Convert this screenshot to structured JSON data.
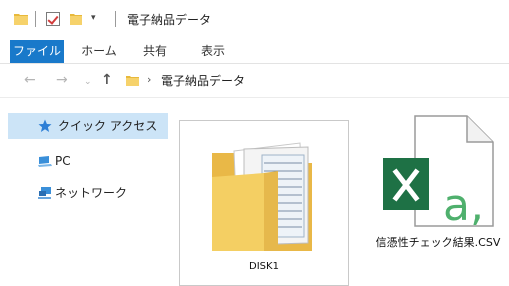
{
  "window": {
    "title": "電子納品データ"
  },
  "quick_access_toolbar": {
    "dropdown_glyph": "▾"
  },
  "ribbon": {
    "tabs": [
      {
        "label": "ファイル",
        "active": true
      },
      {
        "label": "ホーム"
      },
      {
        "label": "共有"
      },
      {
        "label": "表示"
      }
    ]
  },
  "address_bar": {
    "back": "←",
    "forward": "→",
    "recent": "⌄",
    "up": "↑",
    "separator": "›",
    "path": "電子納品データ"
  },
  "navigation_pane": {
    "items": [
      {
        "label": "クイック アクセス",
        "icon": "star-icon",
        "selected": true
      },
      {
        "label": "PC",
        "icon": "computer-icon"
      },
      {
        "label": "ネットワーク",
        "icon": "network-icon"
      }
    ]
  },
  "files": [
    {
      "name": "DISK1",
      "type": "folder",
      "icon": "folder-icon",
      "selected": true
    },
    {
      "name": "信憑性チェック結果.CSV",
      "type": "csv",
      "icon": "excel-csv-icon"
    }
  ],
  "colors": {
    "accent": "#1979ca",
    "selection": "#cce4f7",
    "folder": "#f2c94c",
    "excel_green": "#1e7145"
  }
}
